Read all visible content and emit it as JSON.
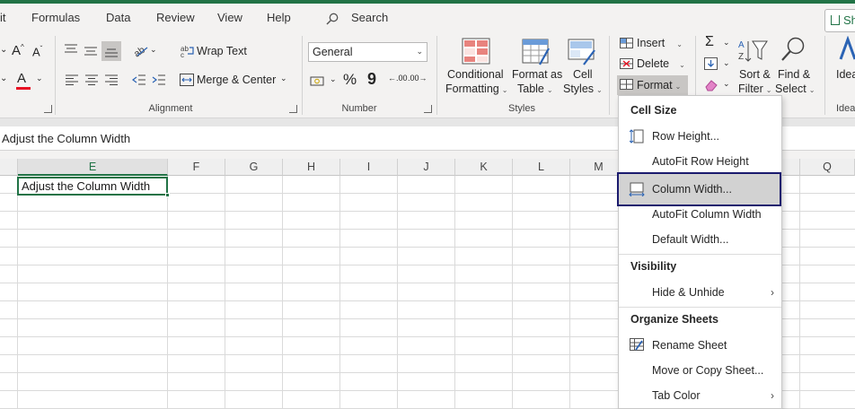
{
  "menubar": {
    "tabs": [
      "it",
      "Formulas",
      "Data",
      "Review",
      "View",
      "Help"
    ],
    "search_label": "Search",
    "share_label": "Sh"
  },
  "ribbon": {
    "font": {
      "increase_font": "A",
      "decrease_font": "A",
      "font_color_letter": "A"
    },
    "alignment": {
      "wrap_text": "Wrap Text",
      "merge_center": "Merge & Center",
      "group_label": "Alignment"
    },
    "number": {
      "format_value": "General",
      "percent": "%",
      "comma": "9",
      "increase_decimal": ".00",
      "decrease_decimal": ".00",
      "group_label": "Number"
    },
    "styles": {
      "conditional_1": "Conditional",
      "conditional_2": "Formatting",
      "format_table_1": "Format as",
      "format_table_2": "Table",
      "cell_styles_1": "Cell",
      "cell_styles_2": "Styles",
      "group_label": "Styles"
    },
    "cells": {
      "insert": "Insert",
      "delete": "Delete",
      "format": "Format"
    },
    "editing": {
      "sort_1": "Sort &",
      "sort_2": "Filter",
      "find_1": "Find &",
      "find_2": "Select"
    },
    "ideas": {
      "label": "Idea",
      "group_label": "Idea"
    },
    "colors": {
      "font_color_bar": "#e81123",
      "green": "#217346"
    }
  },
  "formula_bar": {
    "content": "Adjust the Column Width"
  },
  "columns": [
    "E",
    "F",
    "G",
    "H",
    "I",
    "J",
    "K",
    "L",
    "M",
    "Q"
  ],
  "active_cell": {
    "value": "Adjust the Column Width"
  },
  "format_menu": {
    "cell_size_header": "Cell Size",
    "row_height": "Row Height...",
    "autofit_row": "AutoFit Row Height",
    "column_width": "Column Width...",
    "autofit_column": "AutoFit Column Width",
    "default_width": "Default Width...",
    "visibility_header": "Visibility",
    "hide_unhide": "Hide & Unhide",
    "organize_header": "Organize Sheets",
    "rename_sheet": "Rename Sheet",
    "move_copy": "Move or Copy Sheet...",
    "tab_color": "Tab Color"
  }
}
